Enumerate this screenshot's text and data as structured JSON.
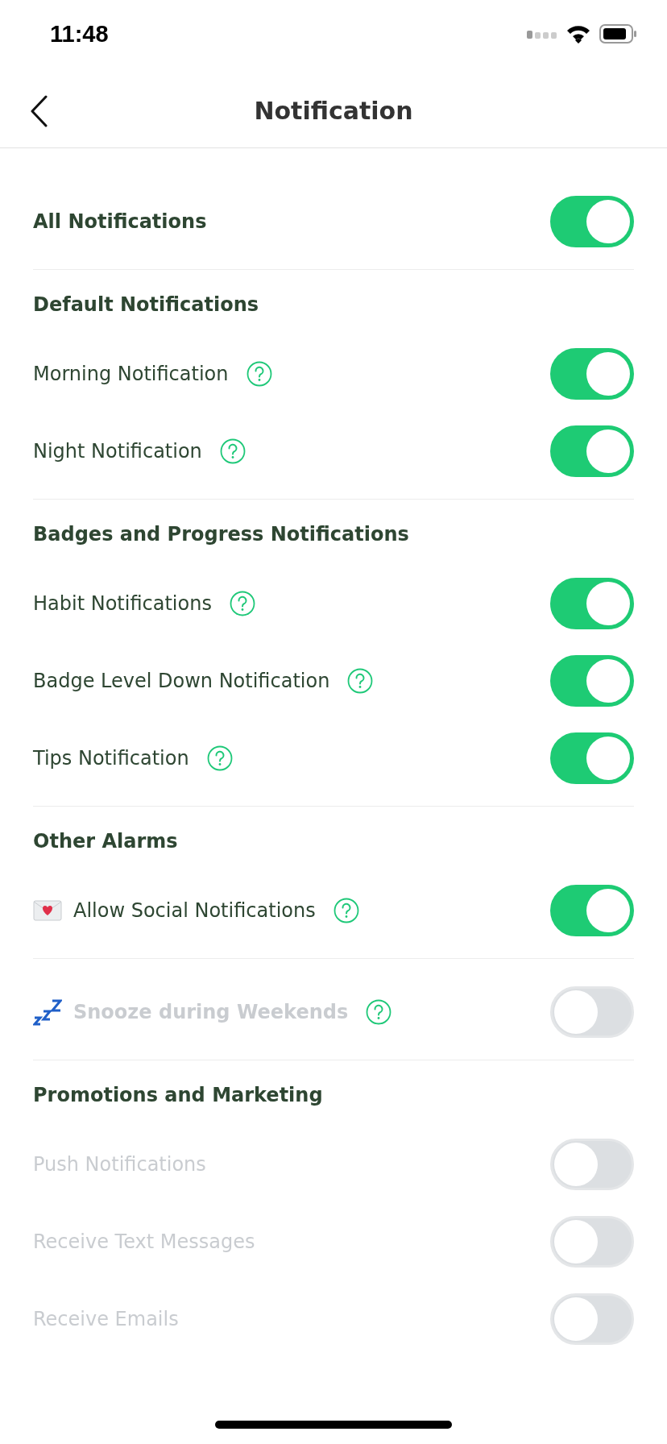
{
  "status_bar": {
    "time": "11:48"
  },
  "nav": {
    "title": "Notification"
  },
  "sections": [
    {
      "items": [
        {
          "label": "All Notifications",
          "kind": "toggle",
          "on": true,
          "disabled": false,
          "bold": true,
          "help": false
        }
      ]
    },
    {
      "header": "Default Notifications",
      "items": [
        {
          "label": "Morning Notification",
          "kind": "toggle",
          "on": true,
          "disabled": false,
          "bold": false,
          "help": true
        },
        {
          "label": "Night Notification",
          "kind": "toggle",
          "on": true,
          "disabled": false,
          "bold": false,
          "help": true
        }
      ]
    },
    {
      "header": "Badges and Progress Notifications",
      "items": [
        {
          "label": "Habit Notifications",
          "kind": "toggle",
          "on": true,
          "disabled": false,
          "bold": false,
          "help": true
        },
        {
          "label": "Badge Level Down Notification",
          "kind": "toggle",
          "on": true,
          "disabled": false,
          "bold": false,
          "help": true
        },
        {
          "label": "Tips Notification",
          "kind": "toggle",
          "on": true,
          "disabled": false,
          "bold": false,
          "help": true
        }
      ]
    },
    {
      "header": "Other Alarms",
      "items": [
        {
          "label": "Allow Social Notifications",
          "kind": "toggle",
          "on": true,
          "disabled": false,
          "bold": false,
          "help": true
        }
      ]
    },
    {
      "items": [
        {
          "label": "Snooze during Weekends",
          "kind": "toggle",
          "on": false,
          "disabled": true,
          "bold": true,
          "help": true
        }
      ]
    },
    {
      "header": "Promotions and Marketing",
      "items": [
        {
          "label": "Push Notifications",
          "kind": "toggle",
          "on": false,
          "disabled": true,
          "bold": false,
          "help": false
        },
        {
          "label": "Receive Text Messages",
          "kind": "toggle",
          "on": false,
          "disabled": true,
          "bold": false,
          "help": false
        },
        {
          "label": "Receive Emails",
          "kind": "toggle",
          "on": false,
          "disabled": true,
          "bold": false,
          "help": false
        }
      ]
    }
  ]
}
